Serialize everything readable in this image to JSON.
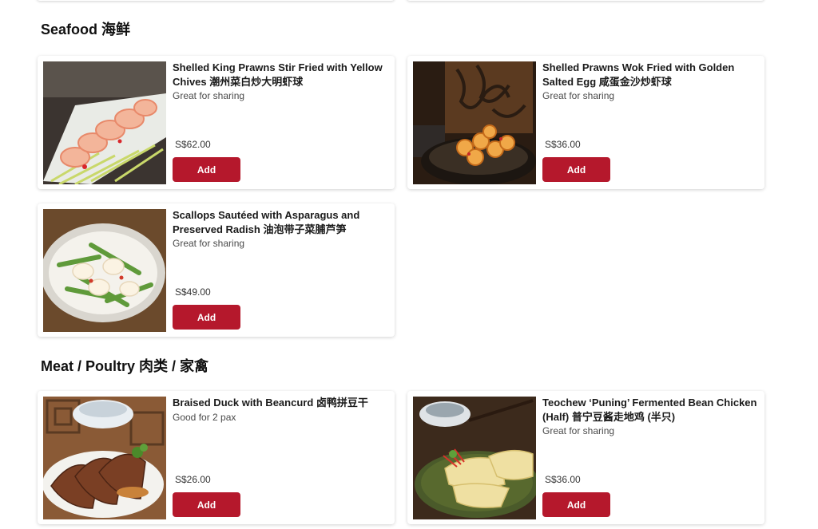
{
  "sections": [
    {
      "title": "Seafood 海鲜",
      "items": [
        {
          "name": "Shelled King Prawns Stir Fried with Yellow Chives 潮州菜白炒大明虾球",
          "description": "Great for sharing",
          "price": "S$62.00",
          "add_label": "Add"
        },
        {
          "name": "Shelled Prawns Wok Fried with Golden Salted Egg 咸蛋金沙炒虾球",
          "description": "Great for sharing",
          "price": "S$36.00",
          "add_label": "Add"
        },
        {
          "name": "Scallops Sautéed with Asparagus and Preserved Radish 油泡带子菜脯芦笋",
          "description": "Great for sharing",
          "price": "S$49.00",
          "add_label": "Add"
        }
      ]
    },
    {
      "title": "Meat / Poultry 肉类 / 家禽",
      "items": [
        {
          "name": "Braised Duck with Beancurd 卤鸭拼豆干",
          "description": "Good for 2 pax",
          "price": "S$26.00",
          "add_label": "Add"
        },
        {
          "name": "Teochew ‘Puning’ Fermented Bean Chicken (Half) 普宁豆酱走地鸡 (半只)",
          "description": "Great for sharing",
          "price": "S$36.00",
          "add_label": "Add"
        }
      ]
    }
  ],
  "colors": {
    "accent": "#b5182c",
    "card_background": "#ffffff",
    "page_background": "#ffffff"
  }
}
